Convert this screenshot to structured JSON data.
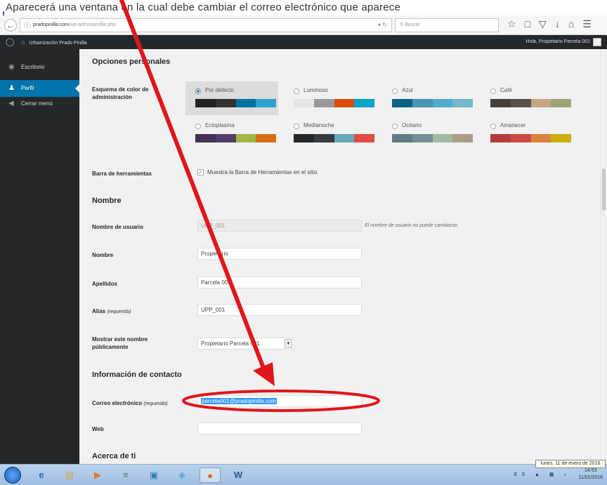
{
  "doc": {
    "text": "Aparecerá una ventana en la cual debe cambiar el correo electrónico que aparece"
  },
  "browser": {
    "url_domain": "pradopinilla.com",
    "url_path": "/wp-admin/profile.php",
    "search_placeholder": "Buscar"
  },
  "adminbar": {
    "site_name": "Urbanización Prado Pinilla",
    "greeting": "Hola, Propietario Parcela 001"
  },
  "sidebar": {
    "items": [
      {
        "label": "Escritorio",
        "icon": "dashboard-icon"
      },
      {
        "label": "Perfil",
        "icon": "user-icon",
        "active": true
      },
      {
        "label": "Cerrar menú",
        "icon": "collapse-icon"
      }
    ]
  },
  "profile": {
    "section_options": "Opciones personales",
    "color_scheme_label": "Esquema de color de administración",
    "schemes": [
      {
        "name": "Por defecto",
        "selected": true,
        "colors": [
          "#222",
          "#333",
          "#0074a2",
          "#2ea2cc"
        ]
      },
      {
        "name": "Luminoso",
        "colors": [
          "#e5e5e5",
          "#999",
          "#d64e07",
          "#04a4cc"
        ]
      },
      {
        "name": "Azul",
        "colors": [
          "#096484",
          "#4796b3",
          "#52accc",
          "#74b6ce"
        ]
      },
      {
        "name": "Café",
        "colors": [
          "#46403c",
          "#59524c",
          "#c7a589",
          "#9ea476"
        ]
      },
      {
        "name": "Ectoplasma",
        "colors": [
          "#413256",
          "#523f6d",
          "#a3b745",
          "#d46f15"
        ]
      },
      {
        "name": "Medianoche",
        "colors": [
          "#25282b",
          "#363b3f",
          "#69a8bb",
          "#e14d43"
        ]
      },
      {
        "name": "Océano",
        "colors": [
          "#627c83",
          "#738e96",
          "#9ebaa0",
          "#aa9d88"
        ]
      },
      {
        "name": "Amanecer",
        "colors": [
          "#b43c38",
          "#cf4944",
          "#dd823b",
          "#ccaf0b"
        ]
      }
    ],
    "toolbar_label": "Barra de herramientas",
    "toolbar_checkbox": "Muestra la Barra de Herramientas en el sitio",
    "section_name": "Nombre",
    "username_label": "Nombre de usuario",
    "username_value": "UPP_001",
    "username_note": "El nombre de usuario no puede cambiarse.",
    "firstname_label": "Nombre",
    "firstname_value": "Propietario",
    "lastname_label": "Apellidos",
    "lastname_value": "Parcela 001",
    "nickname_label": "Alias",
    "nickname_req": "(requerido)",
    "nickname_value": "UPP_001",
    "display_label": "Mostrar este nombre públicamente",
    "display_value": "Propietario Parcela 001",
    "section_contact": "Información de contacto",
    "email_label": "Correo electrónico",
    "email_req": "(requerido)",
    "email_value": "parcela001@pradopinilla.com",
    "web_label": "Web",
    "web_value": "",
    "section_about": "Acerca de ti"
  },
  "taskbar": {
    "apps": [
      {
        "icon": "ie-icon"
      },
      {
        "icon": "folder-icon"
      },
      {
        "icon": "media-player-icon"
      },
      {
        "icon": "notes-icon"
      },
      {
        "icon": "photos-icon"
      },
      {
        "icon": "network-icon"
      },
      {
        "icon": "firefox-icon",
        "active": true
      },
      {
        "icon": "word-icon"
      }
    ],
    "time": "14:53",
    "date_short": "11/01/2016",
    "date_tooltip": "lunes, 11 de enero de 2016"
  }
}
